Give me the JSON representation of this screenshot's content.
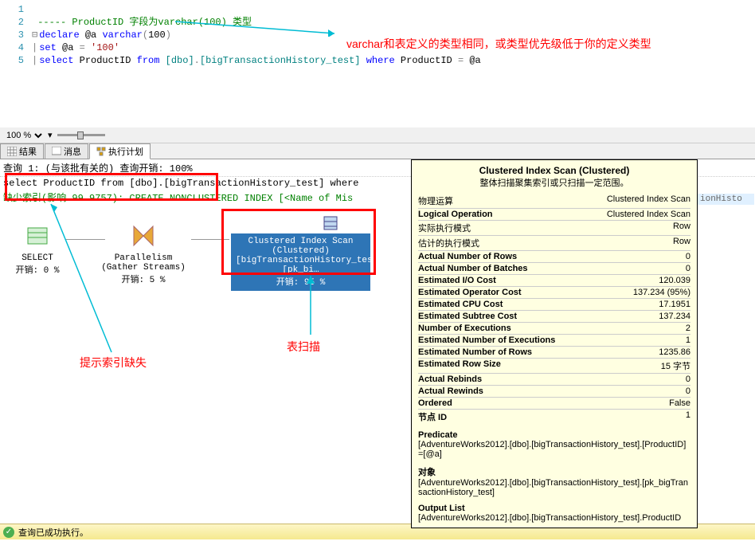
{
  "annotations": {
    "varchar_note": "varchar和表定义的类型相同，或类型优先级低于你的定义类型",
    "missing_index_note": "提示索引缺失",
    "table_scan_note": "表扫描"
  },
  "editor": {
    "lines": [
      {
        "n": "1",
        "segs": []
      },
      {
        "n": "2",
        "segs": [
          {
            "t": "----- ProductID 字段为varchar(100) 类型",
            "c": "c-comment"
          }
        ]
      },
      {
        "n": "3",
        "segs": [
          {
            "t": "declare",
            "c": "c-blue"
          },
          {
            "t": " @a ",
            "c": "c-black"
          },
          {
            "t": "varchar",
            "c": "c-blue"
          },
          {
            "t": "(",
            "c": "c-gray"
          },
          {
            "t": "100",
            "c": "c-black"
          },
          {
            "t": ")",
            "c": "c-gray"
          }
        ]
      },
      {
        "n": "4",
        "segs": [
          {
            "t": "set",
            "c": "c-blue"
          },
          {
            "t": " @a ",
            "c": "c-black"
          },
          {
            "t": "=",
            "c": "c-gray"
          },
          {
            "t": " ",
            "c": "c-black"
          },
          {
            "t": "'100'",
            "c": "c-red"
          }
        ]
      },
      {
        "n": "5",
        "segs": [
          {
            "t": "select",
            "c": "c-blue"
          },
          {
            "t": " ProductID ",
            "c": "c-black"
          },
          {
            "t": "from",
            "c": "c-blue"
          },
          {
            "t": " [dbo]",
            "c": "c-teal"
          },
          {
            "t": ".",
            "c": "c-gray"
          },
          {
            "t": "[bigTransactionHistory_test] ",
            "c": "c-teal"
          },
          {
            "t": "where",
            "c": "c-blue"
          },
          {
            "t": " ProductID ",
            "c": "c-black"
          },
          {
            "t": "=",
            "c": "c-gray"
          },
          {
            "t": " @a",
            "c": "c-black"
          }
        ]
      }
    ]
  },
  "zoom": {
    "value": "100 %"
  },
  "tabs": {
    "results": "结果",
    "messages": "消息",
    "plan": "执行计划"
  },
  "plan": {
    "query_header": "查询 1: (与该批有关的) 查询开销: 100%",
    "query_text": "select ProductID from [dbo].[bigTransactionHistory_test] where",
    "missing_index": "缺少索引(影响 99.9757): CREATE NONCLUSTERED INDEX [<Name of Mis",
    "truncated_row_text": "ionHisto",
    "nodes": {
      "select": {
        "label": "SELECT",
        "cost": "开销: 0 %"
      },
      "parallelism": {
        "label1": "Parallelism",
        "label2": "(Gather Streams)",
        "cost": "开销: 5 %"
      },
      "scan": {
        "line1": "Clustered Index Scan (Clustered)",
        "line2": "[bigTransactionHistory_test].[pk_bi…",
        "cost": "开销: 95 %"
      }
    }
  },
  "tooltip": {
    "title": "Clustered Index Scan (Clustered)",
    "subtitle": "整体扫描聚集索引或只扫描一定范围。",
    "rows": [
      {
        "k": "物理运算",
        "v": "Clustered Index Scan"
      },
      {
        "k": "Logical Operation",
        "v": "Clustered Index Scan",
        "bold": true
      },
      {
        "k": "实际执行模式",
        "v": "Row"
      },
      {
        "k": "估计的执行模式",
        "v": "Row"
      },
      {
        "k": "Actual Number of Rows",
        "v": "0",
        "bold": true
      },
      {
        "k": "Actual Number of Batches",
        "v": "0",
        "bold": true
      },
      {
        "k": "Estimated I/O Cost",
        "v": "120.039",
        "bold": true
      },
      {
        "k": "Estimated Operator Cost",
        "v": "137.234 (95%)",
        "bold": true
      },
      {
        "k": "Estimated CPU Cost",
        "v": "17.1951",
        "bold": true
      },
      {
        "k": "Estimated Subtree Cost",
        "v": "137.234",
        "bold": true
      },
      {
        "k": "Number of Executions",
        "v": "2",
        "bold": true
      },
      {
        "k": "Estimated Number of Executions",
        "v": "1",
        "bold": true
      },
      {
        "k": "Estimated Number of Rows",
        "v": "1235.86",
        "bold": true
      },
      {
        "k": "Estimated Row Size",
        "v": "15 字节",
        "bold": true
      },
      {
        "k": "Actual Rebinds",
        "v": "0",
        "bold": true
      },
      {
        "k": "Actual Rewinds",
        "v": "0",
        "bold": true
      },
      {
        "k": "Ordered",
        "v": "False",
        "bold": true
      },
      {
        "k": "节点 ID",
        "v": "1",
        "bold": true
      }
    ],
    "predicate_label": "Predicate",
    "predicate_text": "[AdventureWorks2012].[dbo].[bigTransactionHistory_test].[ProductID]=[@a]",
    "object_label": "对象",
    "object_text": "[AdventureWorks2012].[dbo].[bigTransactionHistory_test].[pk_bigTransactionHistory_test]",
    "output_label": "Output List",
    "output_text": "[AdventureWorks2012].[dbo].[bigTransactionHistory_test].ProductID"
  },
  "status": {
    "text": "查询已成功执行。"
  }
}
